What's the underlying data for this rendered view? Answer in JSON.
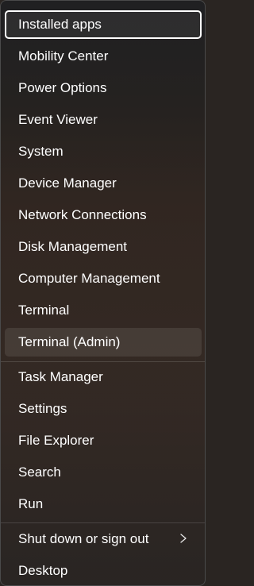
{
  "menu": {
    "items": [
      {
        "label": "Installed apps"
      },
      {
        "label": "Mobility Center"
      },
      {
        "label": "Power Options"
      },
      {
        "label": "Event Viewer"
      },
      {
        "label": "System"
      },
      {
        "label": "Device Manager"
      },
      {
        "label": "Network Connections"
      },
      {
        "label": "Disk Management"
      },
      {
        "label": "Computer Management"
      },
      {
        "label": "Terminal"
      },
      {
        "label": "Terminal (Admin)"
      },
      {
        "label": "Task Manager"
      },
      {
        "label": "Settings"
      },
      {
        "label": "File Explorer"
      },
      {
        "label": "Search"
      },
      {
        "label": "Run"
      },
      {
        "label": "Shut down or sign out"
      },
      {
        "label": "Desktop"
      }
    ],
    "submenu_icon": "chevron-right-icon"
  }
}
